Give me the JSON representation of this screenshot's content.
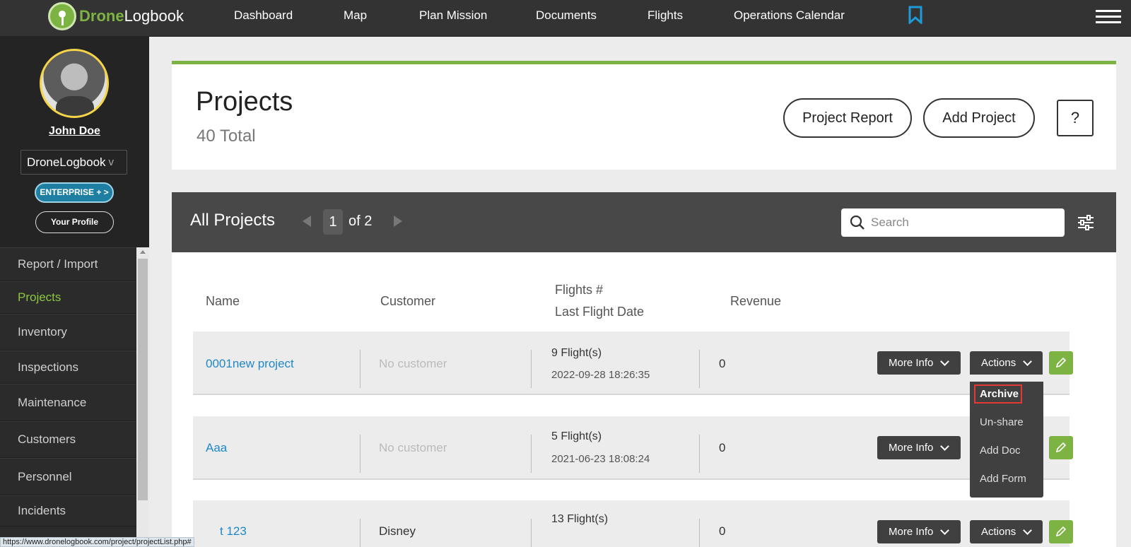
{
  "brand": {
    "prefix": "Drone",
    "suffix": "Logbook",
    "accent": "#7cb342"
  },
  "nav": {
    "items": [
      "Dashboard",
      "Map",
      "Plan Mission",
      "Documents",
      "Flights",
      "Operations Calendar"
    ]
  },
  "user": {
    "name": "John Doe",
    "organization": "DroneLogbook",
    "plan_badge": "ENTERPRISE + >",
    "profile_button": "Your Profile"
  },
  "sidebar": {
    "items": [
      {
        "label": "Report / Import",
        "active": false
      },
      {
        "label": "Projects",
        "active": true
      },
      {
        "label": "Inventory",
        "active": false
      },
      {
        "label": "Inspections",
        "active": false
      },
      {
        "label": "Maintenance",
        "active": false
      },
      {
        "label": "Customers",
        "active": false
      },
      {
        "label": "Personnel",
        "active": false
      },
      {
        "label": "Incidents",
        "active": false
      }
    ]
  },
  "header": {
    "title": "Projects",
    "total": "40 Total",
    "report_button": "Project Report",
    "add_button": "Add Project",
    "help_button": "?"
  },
  "list": {
    "title": "All Projects",
    "current_page": "1",
    "page_of": "of 2",
    "search_placeholder": "Search",
    "columns": {
      "name": "Name",
      "customer": "Customer",
      "flights": "Flights #",
      "last_flight": "Last Flight Date",
      "revenue": "Revenue"
    },
    "rows": [
      {
        "name": "0001new project",
        "customer": "No customer",
        "flights": "9 Flight(s)",
        "date": "2022-09-28 18:26:35",
        "revenue": "0"
      },
      {
        "name": "Aaa",
        "customer": "No customer",
        "flights": "5 Flight(s)",
        "date": "2021-06-23 18:08:24",
        "revenue": "0"
      },
      {
        "name": "t 123",
        "customer": "Disney",
        "flights": "13 Flight(s)",
        "date": "",
        "revenue": "0"
      }
    ],
    "more_info_label": "More Info",
    "actions_label": "Actions"
  },
  "actions_menu": {
    "items": [
      "Archive",
      "Un-share",
      "Add Doc",
      "Add Form"
    ],
    "highlighted": "Archive"
  },
  "status_url": "https://www.dronelogbook.com/project/projectList.php#"
}
